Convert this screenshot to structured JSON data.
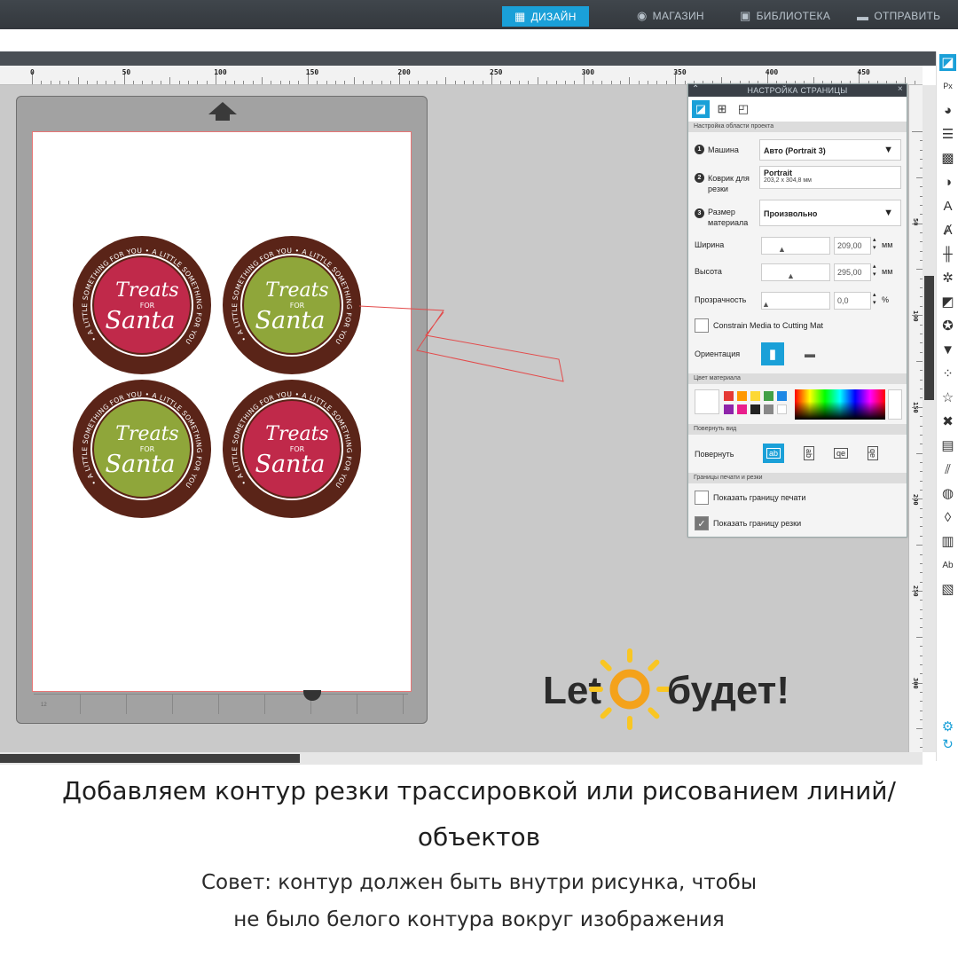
{
  "nav": {
    "tabs": [
      {
        "label": "ДИЗАЙН",
        "icon": "grid-icon",
        "active": true
      },
      {
        "label": "МАГАЗИН",
        "icon": "store-icon",
        "active": false
      },
      {
        "label": "БИБЛИОТЕКА",
        "icon": "library-icon",
        "active": false
      },
      {
        "label": "ОТПРАВИТЬ",
        "icon": "send-icon",
        "active": false
      }
    ]
  },
  "ruler": {
    "h_labels": [
      "0",
      "50",
      "100",
      "150",
      "200",
      "250",
      "300",
      "350",
      "400",
      "450"
    ],
    "v_labels": [
      "50",
      "100",
      "150",
      "200",
      "250",
      "300"
    ]
  },
  "mat": {
    "label": "12"
  },
  "badges": [
    {
      "color": "red",
      "outer_text": "• A LITTLE SOMETHING FOR YOU • A LITTLE SOMETHING FOR YOU",
      "line1": "Treats",
      "line2": "FOR",
      "line3": "Santa"
    },
    {
      "color": "green",
      "outer_text": "• A LITTLE SOMETHING FOR YOU • A LITTLE SOMETHING FOR YOU",
      "line1": "Treats",
      "line2": "FOR",
      "line3": "Santa"
    },
    {
      "color": "green",
      "outer_text": "• A LITTLE SOMETHING FOR YOU • A LITTLE SOMETHING FOR YOU",
      "line1": "Treats",
      "line2": "FOR",
      "line3": "Santa"
    },
    {
      "color": "red",
      "outer_text": "• A LITTLE SOMETHING FOR YOU • A LITTLE SOMETHING FOR YOU",
      "line1": "Treats",
      "line2": "FOR",
      "line3": "Santa"
    }
  ],
  "colors": {
    "red": "#c0294a",
    "green": "#8fa63a",
    "rim": "#5a2418",
    "accent": "#1aa0d8"
  },
  "panel": {
    "title": "НАСТРОЙКА СТРАНИЦЫ",
    "section_area": "Настройка области проекта",
    "machine_label": "Машина",
    "machine_value": "Авто (Portrait 3)",
    "mat_label": "Коврик для резки",
    "mat_value": "Portrait",
    "mat_size": "203,2 x 304,8 мм",
    "media_label": "Размер материала",
    "media_value": "Произвольно",
    "width_label": "Ширина",
    "width_value": "209,00",
    "width_unit": "мм",
    "height_label": "Высота",
    "height_value": "295,00",
    "height_unit": "мм",
    "opacity_label": "Прозрачность",
    "opacity_value": "0,0",
    "opacity_unit": "%",
    "constrain_label": "Constrain Media to Cutting Mat",
    "orientation_label": "Ориентация",
    "section_color": "Цвет материала",
    "section_rotate": "Повернуть вид",
    "rotate_label": "Повернуть",
    "rotate_options": [
      "ab",
      "ab",
      "qe",
      "qe"
    ],
    "section_borders": "Границы печати и резки",
    "print_border_label": "Показать границу печати",
    "cut_border_label": "Показать границу резки",
    "swatches": [
      "#e53935",
      "#ff9800",
      "#fdd835",
      "#43a047",
      "#1e88e5",
      "#8e24aa",
      "#e91e8c",
      "#222222",
      "#888888",
      "#ffffff"
    ]
  },
  "logo": {
    "text_left": "Let",
    "text_right": "будет!"
  },
  "caption": {
    "main": "Добавляем контур резки трассировкой или рисованием линий/ объектов",
    "tip_line1": "Совет: контур должен быть внутри рисунка, чтобы",
    "tip_line2": "не было белого контура вокруг изображения"
  }
}
